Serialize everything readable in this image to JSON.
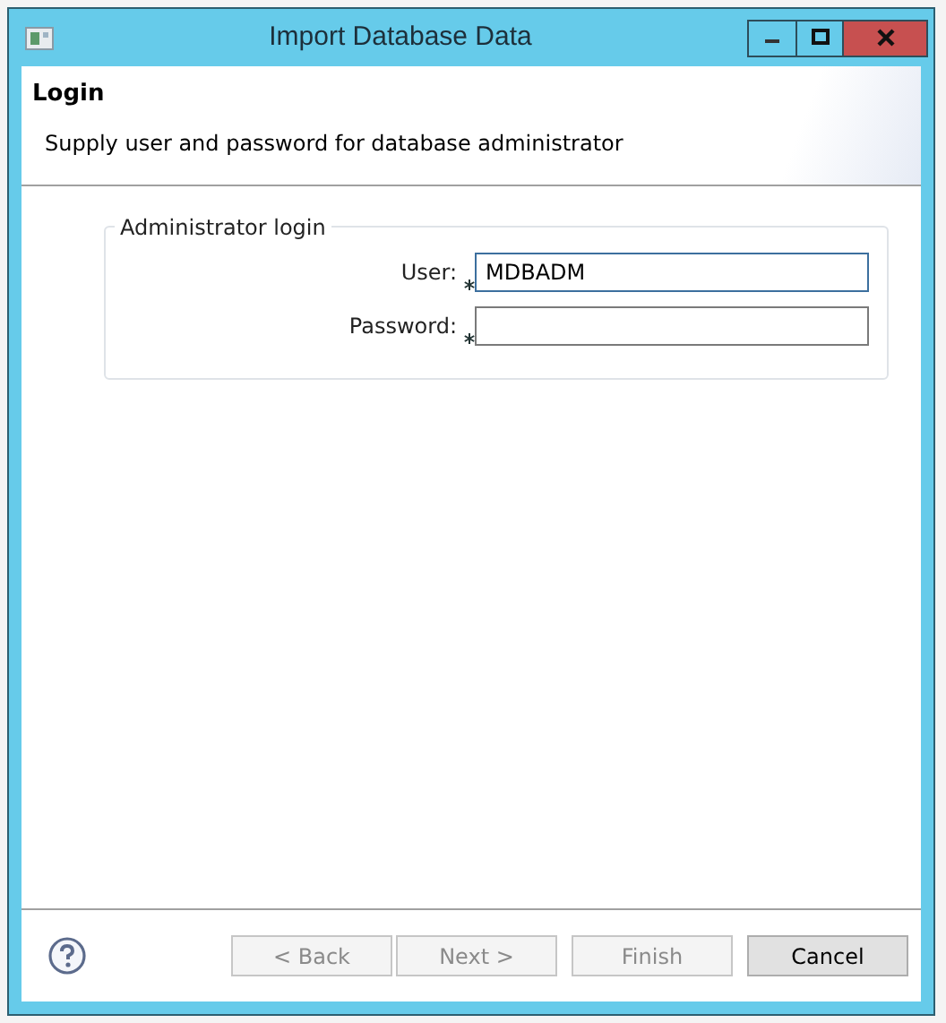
{
  "window": {
    "title": "Import Database Data"
  },
  "header": {
    "title": "Login",
    "description": "Supply user and password for database administrator"
  },
  "group": {
    "title": "Administrator login",
    "fields": [
      {
        "label": "User:",
        "value": "MDBADM",
        "required": true,
        "focused": true
      },
      {
        "label": "Password:",
        "required": true,
        "focused": false
      }
    ]
  },
  "buttons": [
    {
      "label": "< Back",
      "disabled": true
    },
    {
      "label": "Next >",
      "disabled": true
    },
    {
      "label": "Finish",
      "disabled": true
    },
    {
      "label": "Cancel",
      "disabled": false
    }
  ]
}
